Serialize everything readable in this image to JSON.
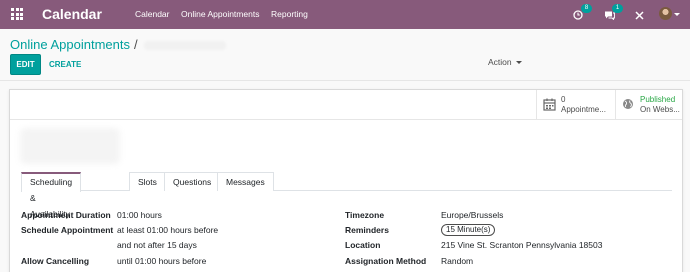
{
  "navbar": {
    "app_title": "Calendar",
    "menu": [
      "Calendar",
      "Online Appointments",
      "Reporting"
    ],
    "activity_count": "8",
    "message_count": "1",
    "icons": [
      "apps-icon",
      "clock-icon",
      "chat-icon",
      "close-icon"
    ]
  },
  "breadcrumb": {
    "parent": "Online Appointments",
    "separator": "/"
  },
  "buttons": {
    "edit": "EDIT",
    "create": "CREATE",
    "action": "Action"
  },
  "smart_buttons": {
    "appointments": {
      "count": "0",
      "label": "Appointme..."
    },
    "website": {
      "status": "Published",
      "label": "On Webs..."
    }
  },
  "tabs": [
    "Scheduling & Availability",
    "Slots",
    "Questions",
    "Messages"
  ],
  "fields_left": [
    {
      "label": "Appointment Duration",
      "value": "01:00 hours"
    },
    {
      "label": "Schedule Appointment",
      "value": "at least 01:00 hours before"
    },
    {
      "label": "",
      "value": "and not after 15 days"
    },
    {
      "label": "Allow Cancelling",
      "value": "until 01:00 hours before"
    }
  ],
  "fields_right": [
    {
      "label": "Timezone",
      "value": "Europe/Brussels"
    },
    {
      "label": "Reminders",
      "value": "15 Minute(s)"
    },
    {
      "label": "Location",
      "value": "215 Vine St. Scranton Pennsylvania 18503"
    },
    {
      "label": "Assignation Method",
      "value": "Random"
    }
  ],
  "colors": {
    "brand": "#875a7b",
    "accent": "#00a09d",
    "published": "#28a745"
  }
}
